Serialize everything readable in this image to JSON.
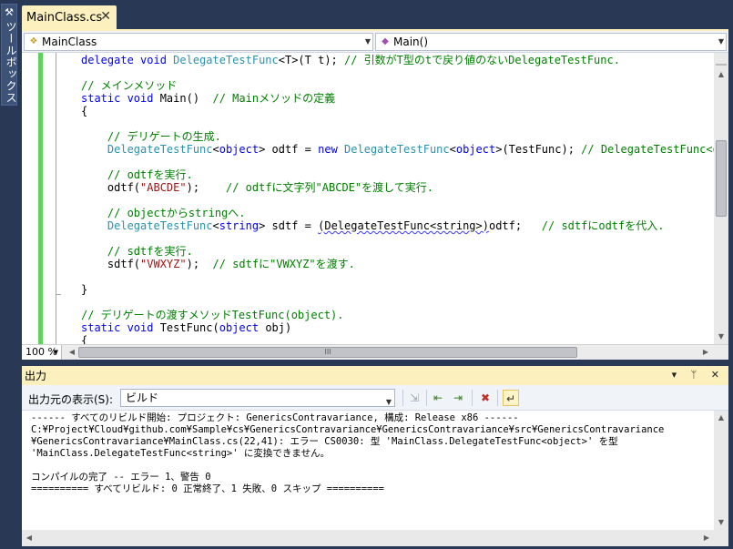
{
  "toolbox": {
    "label": "ツールボックス",
    "icon": "toolbox-icon"
  },
  "document_tab": {
    "title": "MainClass.cs",
    "close": "✕"
  },
  "nav": {
    "class_combo": "MainClass",
    "member_combo": "Main()"
  },
  "code": {
    "lines": [
      {
        "parts": [
          [
            "kw",
            "delegate "
          ],
          [
            "kw",
            "void "
          ],
          [
            "ty",
            "DelegateTestFunc"
          ],
          [
            "",
            "<T>(T t); "
          ],
          [
            "cm",
            "// 引数がT型のtで戻り値のないDelegateTestFunc."
          ]
        ]
      },
      {
        "parts": []
      },
      {
        "parts": [
          [
            "cm",
            "// メインメソッド"
          ]
        ]
      },
      {
        "parts": [
          [
            "kw",
            "static "
          ],
          [
            "kw",
            "void "
          ],
          [
            "",
            "Main()  "
          ],
          [
            "cm",
            "// Mainメソッドの定義"
          ]
        ]
      },
      {
        "parts": [
          [
            "",
            "{"
          ]
        ]
      },
      {
        "parts": []
      },
      {
        "parts": [
          [
            "",
            "    "
          ],
          [
            "cm",
            "// デリゲートの生成."
          ]
        ]
      },
      {
        "parts": [
          [
            "",
            "    "
          ],
          [
            "ty",
            "DelegateTestFunc"
          ],
          [
            "",
            "<"
          ],
          [
            "kw",
            "object"
          ],
          [
            "",
            "> odtf = "
          ],
          [
            "kw",
            "new "
          ],
          [
            "ty",
            "DelegateTestFunc"
          ],
          [
            "",
            "<"
          ],
          [
            "kw",
            "object"
          ],
          [
            "",
            ">(TestFunc); "
          ],
          [
            "cm",
            "// DelegateTestFunc<obj"
          ]
        ]
      },
      {
        "parts": []
      },
      {
        "parts": [
          [
            "",
            "    "
          ],
          [
            "cm",
            "// odtfを実行."
          ]
        ]
      },
      {
        "parts": [
          [
            "",
            "    odtf("
          ],
          [
            "st",
            "\"ABCDE\""
          ],
          [
            "",
            ");    "
          ],
          [
            "cm",
            "// odtfに文字列\"ABCDE\"を渡して実行."
          ]
        ]
      },
      {
        "parts": []
      },
      {
        "parts": [
          [
            "",
            "    "
          ],
          [
            "cm",
            "// objectからstringへ."
          ]
        ]
      },
      {
        "parts": [
          [
            "",
            "    "
          ],
          [
            "ty",
            "DelegateTestFunc"
          ],
          [
            "",
            "<"
          ],
          [
            "kw",
            "string"
          ],
          [
            "",
            "> sdtf = "
          ],
          [
            "squig",
            "(DelegateTestFunc<string>)"
          ],
          [
            "",
            "odtf;   "
          ],
          [
            "cm",
            "// sdtfにodtfを代入."
          ]
        ]
      },
      {
        "parts": []
      },
      {
        "parts": [
          [
            "",
            "    "
          ],
          [
            "cm",
            "// sdtfを実行."
          ]
        ]
      },
      {
        "parts": [
          [
            "",
            "    sdtf("
          ],
          [
            "st",
            "\"VWXYZ\""
          ],
          [
            "",
            ");  "
          ],
          [
            "cm",
            "// sdtfに\"VWXYZ\"を渡す."
          ]
        ]
      },
      {
        "parts": []
      },
      {
        "parts": [
          [
            "",
            "}"
          ]
        ]
      },
      {
        "parts": []
      },
      {
        "parts": [
          [
            "cm",
            "// デリゲートの渡すメソッドTestFunc(object)."
          ]
        ]
      },
      {
        "parts": [
          [
            "kw",
            "static "
          ],
          [
            "kw",
            "void "
          ],
          [
            "",
            "TestFunc("
          ],
          [
            "kw",
            "object "
          ],
          [
            "",
            "obj)"
          ]
        ]
      },
      {
        "parts": [
          [
            "",
            "{"
          ]
        ]
      }
    ]
  },
  "editor_status": {
    "zoom": "100 %",
    "h_thumb_grip": "III"
  },
  "output": {
    "title": "出力",
    "header_buttons": "▾ ᛘ ✕",
    "source_label": "出力元の表示(S):",
    "source_value": "ビルド",
    "lines": [
      "------ すべてのリビルド開始: プロジェクト: GenericsContravariance, 構成: Release x86 ------",
      "C:¥Project¥Cloud¥github.com¥Sample¥cs¥GenericsContravariance¥GenericsContravariance¥src¥GenericsContravariance",
      "¥GenericsContravariance¥MainClass.cs(22,41): エラー CS0030: 型 'MainClass.DelegateTestFunc<object>' を型",
      "'MainClass.DelegateTestFunc<string>' に変換できません。",
      "",
      "コンパイルの完了 -- エラー 1、警告 0",
      "========== すべてリビルド: 0 正常終了、1 失敗、0 スキップ =========="
    ]
  },
  "colors": {
    "frame": "#293955",
    "tab_active": "#fcf1be",
    "keyword": "#0000ff",
    "type": "#2b91af",
    "comment": "#008000",
    "string": "#a31515",
    "change_bar": "#5ed35b"
  }
}
